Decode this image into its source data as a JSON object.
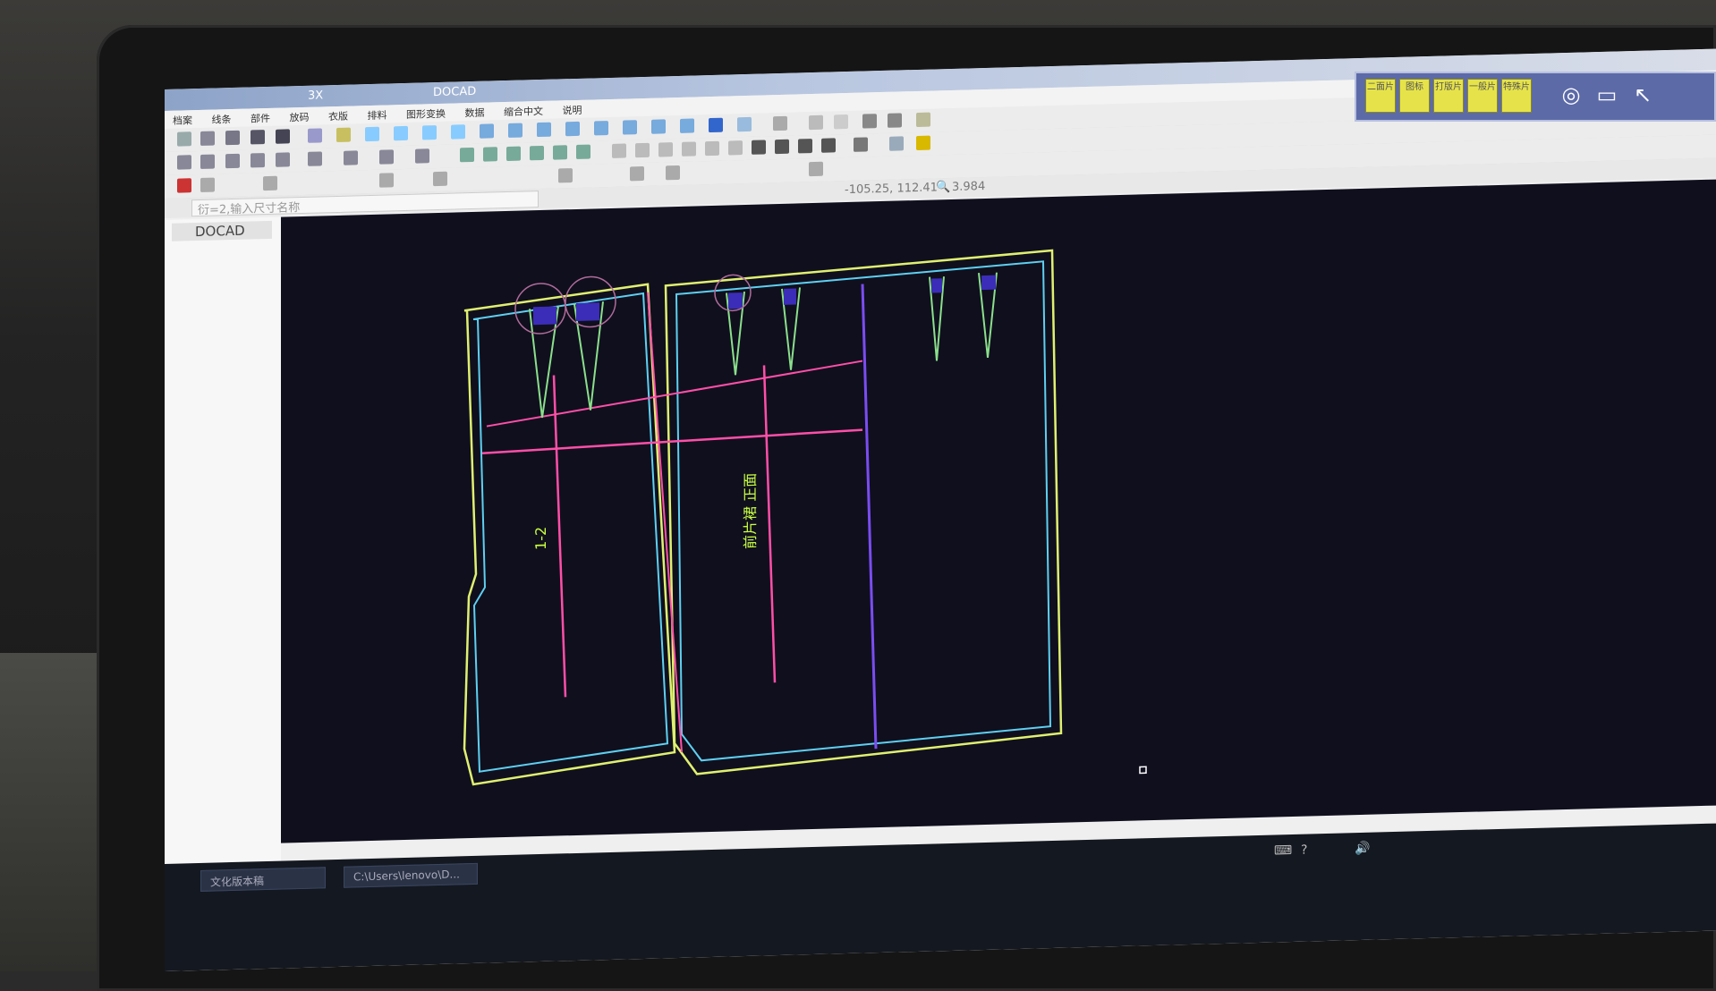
{
  "app": {
    "title_product": "DOCAD",
    "title_suffix": "",
    "title_fragment": "3X",
    "menu": [
      "档案",
      "线条",
      "部件",
      "放码",
      "衣版",
      "排料",
      "图形变换",
      "数据",
      "缩合中文",
      "说明"
    ],
    "command_prompt": "衍=2,输入尺寸名称",
    "coordinates": "-105.25, 112.41",
    "zoom_value": "3.984",
    "panel_title": "DOCAD",
    "taskbar_items": [
      "文化版本稿",
      "C:\\Users\\lenovo\\D..."
    ],
    "annotations": {
      "left_piece_label": "1-2",
      "right_piece_label": "前片裙 正面"
    },
    "overlay_buttons": [
      "二面片",
      "图标",
      "打版片",
      "一般片",
      "特殊片"
    ],
    "icons": [
      "globe-icon",
      "monitor-icon",
      "cursor-icon"
    ]
  },
  "colors": {
    "canvas_bg": "#100f1e",
    "yellow_outline": "#e0f070",
    "cyan_outline": "#5ed0f0",
    "magenta_line": "#ff4fa8",
    "green_dart": "#8be08b",
    "purple_line": "#7a4df0",
    "blue_fill": "#3b2db8"
  }
}
